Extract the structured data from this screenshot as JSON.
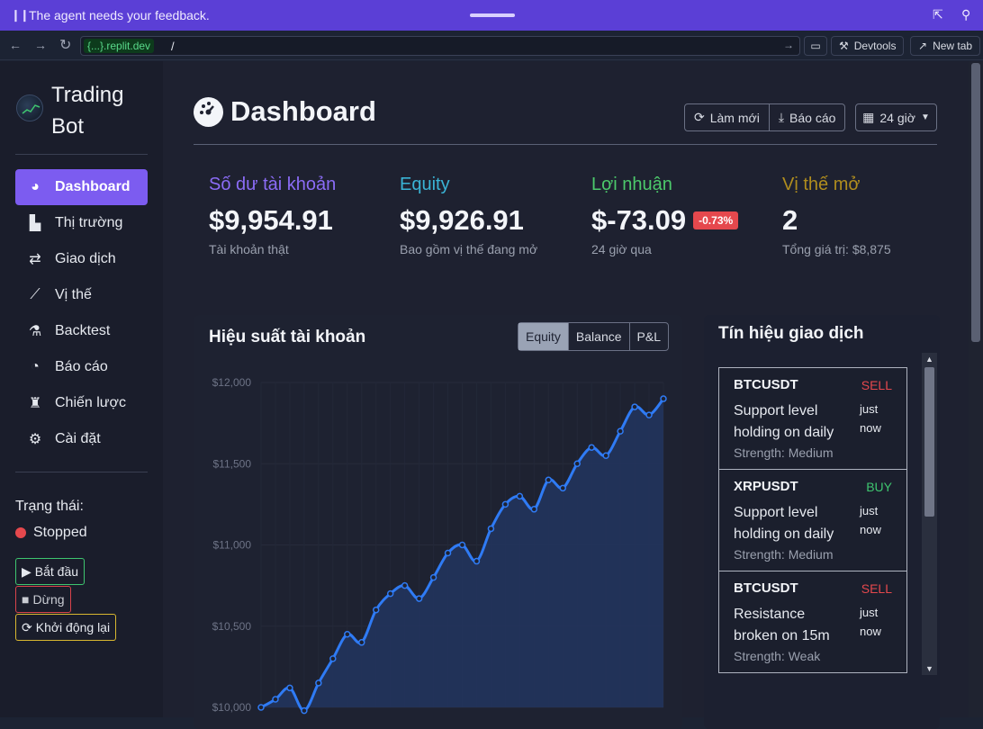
{
  "banner": {
    "message": "The agent needs your feedback."
  },
  "browser": {
    "domain": "{...}.replit.dev",
    "path": "/",
    "devtools_label": "Devtools",
    "newtab_label": "New tab"
  },
  "sidebar": {
    "brand": "Trading Bot",
    "items": [
      {
        "label": "Dashboard",
        "icon": "dashboard-icon",
        "active": true
      },
      {
        "label": "Thị trường",
        "icon": "bar-chart-icon"
      },
      {
        "label": "Giao dịch",
        "icon": "exchange-icon"
      },
      {
        "label": "Vị thế",
        "icon": "line-chart-icon"
      },
      {
        "label": "Backtest",
        "icon": "flask-icon"
      },
      {
        "label": "Báo cáo",
        "icon": "pie-chart-icon"
      },
      {
        "label": "Chiến lược",
        "icon": "chess-icon"
      },
      {
        "label": "Cài đặt",
        "icon": "gear-icon"
      }
    ],
    "status_label": "Trạng thái:",
    "status_value": "Stopped",
    "start_label": "Bắt đầu",
    "stop_label": "Dừng",
    "restart_label": "Khởi động lại"
  },
  "header": {
    "title": "Dashboard",
    "refresh_label": "Làm mới",
    "report_label": "Báo cáo",
    "range_label": "24 giờ"
  },
  "stats": [
    {
      "label": "Số dư tài khoản",
      "value": "$9,954.91",
      "sub": "Tài khoản thật",
      "color": "#8b6cf6"
    },
    {
      "label": "Equity",
      "value": "$9,926.91",
      "sub": "Bao gồm vị thế đang mở",
      "color": "#3ab4d6"
    },
    {
      "label": "Lợi nhuận",
      "value": "$-73.09",
      "badge": "-0.73%",
      "sub": "24 giờ qua",
      "color": "#4cc96b"
    },
    {
      "label": "Vị thế mở",
      "value": "2",
      "sub": "Tổng giá trị: $8,875",
      "color": "#b08d1e"
    }
  ],
  "performance": {
    "title": "Hiệu suất tài khoản",
    "tabs": [
      "Equity",
      "Balance",
      "P&L"
    ],
    "active_tab": "Equity"
  },
  "chart_data": {
    "type": "area",
    "title": "",
    "xlabel": "",
    "ylabel": "",
    "ylim": [
      10000,
      12000
    ],
    "yticks": [
      "$12,000",
      "$11,500",
      "$11,000",
      "$10,500",
      "$10,000"
    ],
    "ytick_values": [
      12000,
      11500,
      11000,
      10500,
      10000
    ],
    "grid": true,
    "series": [
      {
        "values": [
          10000,
          10050,
          10120,
          9980,
          10150,
          10300,
          10450,
          10400,
          10600,
          10700,
          10750,
          10670,
          10800,
          10950,
          11000,
          10900,
          11100,
          11250,
          11300,
          11220,
          11400,
          11350,
          11500,
          11600,
          11550,
          11700,
          11850,
          11800,
          11900
        ],
        "color": "#2f7bf5"
      }
    ]
  },
  "signals": {
    "title": "Tín hiệu giao dịch",
    "items": [
      {
        "symbol": "BTCUSDT",
        "side": "SELL",
        "side_color": "#e5484d",
        "desc": "Support level holding on daily",
        "time": "just now",
        "strength": "Strength: Medium"
      },
      {
        "symbol": "XRPUSDT",
        "side": "BUY",
        "side_color": "#3ec56f",
        "desc": "Support level holding on daily",
        "time": "just now",
        "strength": "Strength: Medium"
      },
      {
        "symbol": "BTCUSDT",
        "side": "SELL",
        "side_color": "#e5484d",
        "desc": "Resistance broken on 15m",
        "time": "just now",
        "strength": "Strength: Weak"
      }
    ]
  }
}
